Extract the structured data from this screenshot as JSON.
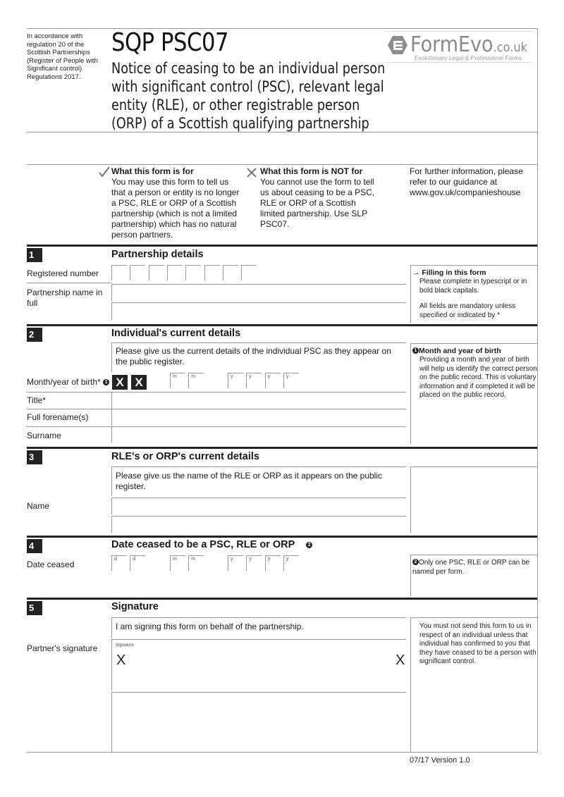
{
  "header": {
    "regulation_text": "In accordance with regulation 20 of the Scottish Partnerships (Register of People with Significant control) Regulations 2017.",
    "form_code": "SQP PSC07",
    "title_lines": [
      "Notice of ceasing to be an individual person",
      "with significant control (PSC), relevant legal",
      "entity (RLE), or other registrable person",
      "(ORP) of a Scottish qualifying partnership"
    ],
    "logo": {
      "brand": "FormEvo",
      "suffix": ".co.uk",
      "tagline": "Evolutionary Legal & Professional Forms",
      "icon": "formevo-logo-icon"
    }
  },
  "intro": {
    "for": {
      "icon": "checkmark-icon",
      "heading": "What this form is for",
      "body": "You may use this form to tell us that a person or entity is no longer a PSC, RLE or ORP of a Scottish partnership (which is not a limited partnership) which has no natural person partners."
    },
    "not_for": {
      "icon": "cross-icon",
      "heading": "What this form is NOT for",
      "body": "You cannot use the form to tell us about ceasing to be a PSC, RLE or ORP of a Scottish limited partnership. Use SLP PSC07."
    },
    "further_info": "For further information, please refer to our guidance at www.gov.uk/companieshouse"
  },
  "sections": {
    "s1": {
      "number": "1",
      "title": "Partnership details",
      "registered_number_label": "Registered number",
      "registered_number_boxes": 8,
      "partnership_name_label": "Partnership name in full",
      "note": {
        "icon": "arrow-right-icon",
        "heading": "Filling in this form",
        "body1": "Please complete in typescript or in bold black capitals.",
        "body2": "All fields are mandatory unless specified or indicated by *"
      }
    },
    "s2": {
      "number": "2",
      "title": "Individual's current details",
      "instruction": "Please give us the current details of the individual PSC as they appear on the public register.",
      "dob_label": "Month/year of birth*",
      "dob_note_marker": "1",
      "dob_blocked": [
        "X",
        "X"
      ],
      "dob_month_placeholders": [
        "m",
        "m"
      ],
      "dob_year_placeholders": [
        "y",
        "y",
        "y",
        "y"
      ],
      "title_label": "Title*",
      "forenames_label": "Full forename(s)",
      "surname_label": "Surname",
      "note": {
        "marker": "1",
        "heading": "Month and year of birth",
        "body": "Providing a month and year of birth will help us identify the correct person on the public record. This is voluntary information and if completed it will be placed on the public record."
      }
    },
    "s3": {
      "number": "3",
      "title": "RLE's or ORP's current details",
      "instruction": "Please give us the name of the RLE or ORP as it appears on the public register.",
      "name_label": "Name"
    },
    "s4": {
      "number": "4",
      "title": "Date ceased to be a PSC, RLE or ORP",
      "title_marker": "2",
      "date_label": "Date ceased",
      "day_placeholders": [
        "d",
        "d"
      ],
      "month_placeholders": [
        "m",
        "m"
      ],
      "year_placeholders": [
        "y",
        "y",
        "y",
        "y"
      ],
      "note": {
        "marker": "2",
        "body": "Only one PSC, RLE or ORP can be named per form."
      }
    },
    "s5": {
      "number": "5",
      "title": "Signature",
      "statement": "I am signing this form on behalf of the partnership.",
      "signature_label": "Partner's signature",
      "signature_box_caption": "Signature",
      "sign_marks": [
        "X",
        "X"
      ],
      "note": "You must not send this form to us in respect of an individual unless that individual has confirmed to you that they have ceased to be a person with significant control."
    }
  },
  "footer": {
    "version": "07/17 Version 1.0"
  }
}
